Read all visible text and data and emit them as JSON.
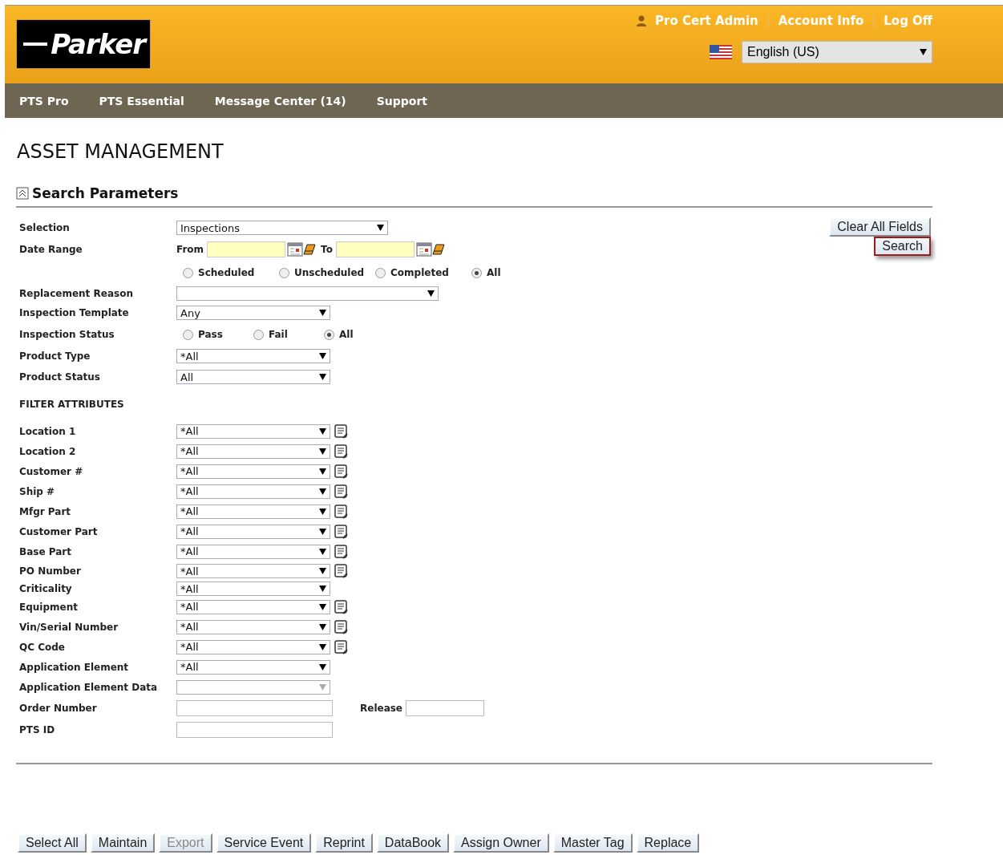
{
  "header": {
    "logo": "Parker",
    "user": "Pro Cert Admin",
    "links": [
      "Account Info",
      "Log Off"
    ],
    "language": "English (US)"
  },
  "nav": [
    "PTS Pro",
    "PTS Essential",
    "Message Center (14)",
    "Support"
  ],
  "page_title": "ASSET MANAGEMENT",
  "section": {
    "title": "Search Parameters",
    "expanded": true
  },
  "actions": [
    {
      "label": "Clear All Fields",
      "focused": false
    },
    {
      "label": "Search",
      "focused": true
    }
  ],
  "selection": {
    "label": "Selection",
    "value": "Inspections"
  },
  "date_range": {
    "label": "Date Range",
    "from_label": "From",
    "to_label": "To"
  },
  "schedule_filter": [
    {
      "label": "Scheduled",
      "selected": false
    },
    {
      "label": "Unscheduled",
      "selected": false
    },
    {
      "label": "Completed",
      "selected": false
    },
    {
      "label": "All",
      "selected": true
    }
  ],
  "replacement_reason": {
    "label": "Replacement Reason"
  },
  "inspection_template": {
    "label": "Inspection Template",
    "value": "Any"
  },
  "inspection_status": {
    "label": "Inspection Status",
    "options": [
      {
        "label": "Pass",
        "selected": false
      },
      {
        "label": "Fail",
        "selected": false
      },
      {
        "label": "All",
        "selected": true
      }
    ]
  },
  "product_type": {
    "label": "Product Type",
    "value": "*All"
  },
  "product_status": {
    "label": "Product Status",
    "value": "All"
  },
  "filter_heading": "FILTER ATTRIBUTES",
  "filters": [
    {
      "kind": "select",
      "label": "Location 1",
      "value": "*All",
      "lookup": true,
      "disabled": false
    },
    {
      "kind": "select",
      "label": "Location 2",
      "value": "*All",
      "lookup": true,
      "disabled": false
    },
    {
      "kind": "select",
      "label": "Customer #",
      "value": "*All",
      "lookup": true,
      "disabled": false
    },
    {
      "kind": "select",
      "label": "Ship #",
      "value": "*All",
      "lookup": true,
      "disabled": false
    },
    {
      "kind": "select",
      "label": "Mfgr Part",
      "value": "*All",
      "lookup": true,
      "disabled": false
    },
    {
      "kind": "select",
      "label": "Customer Part",
      "value": "*All",
      "lookup": true,
      "disabled": false
    },
    {
      "kind": "select",
      "label": "Base Part",
      "value": "*All",
      "lookup": true,
      "disabled": false
    },
    {
      "kind": "select",
      "label": "PO Number",
      "value": "*All",
      "lookup": true,
      "disabled": false
    },
    {
      "kind": "select",
      "label": "Criticality",
      "value": "*All",
      "lookup": false,
      "disabled": false
    },
    {
      "kind": "select",
      "label": "Equipment",
      "value": "*All",
      "lookup": true,
      "disabled": false
    },
    {
      "kind": "select",
      "label": "Vin/Serial Number",
      "value": "*All",
      "lookup": true,
      "disabled": false
    },
    {
      "kind": "select",
      "label": "QC Code",
      "value": "*All",
      "lookup": true,
      "disabled": false
    },
    {
      "kind": "select",
      "label": "Application Element",
      "value": "*All",
      "lookup": false,
      "disabled": false
    },
    {
      "kind": "select",
      "label": "Application Element Data",
      "lookup": false,
      "disabled": true
    },
    {
      "kind": "text",
      "label": "Order Number",
      "extra_label": "Release"
    },
    {
      "kind": "text",
      "label": "PTS ID"
    }
  ],
  "bottom_buttons": [
    {
      "label": "Select All",
      "disabled": false
    },
    {
      "label": "Maintain",
      "disabled": false
    },
    {
      "label": "Export",
      "disabled": true
    },
    {
      "label": "Service Event",
      "disabled": false
    },
    {
      "label": "Reprint",
      "disabled": false
    },
    {
      "label": "DataBook",
      "disabled": false
    },
    {
      "label": "Assign Owner",
      "disabled": false
    },
    {
      "label": "Master Tag",
      "disabled": false
    },
    {
      "label": "Replace",
      "disabled": false
    }
  ]
}
